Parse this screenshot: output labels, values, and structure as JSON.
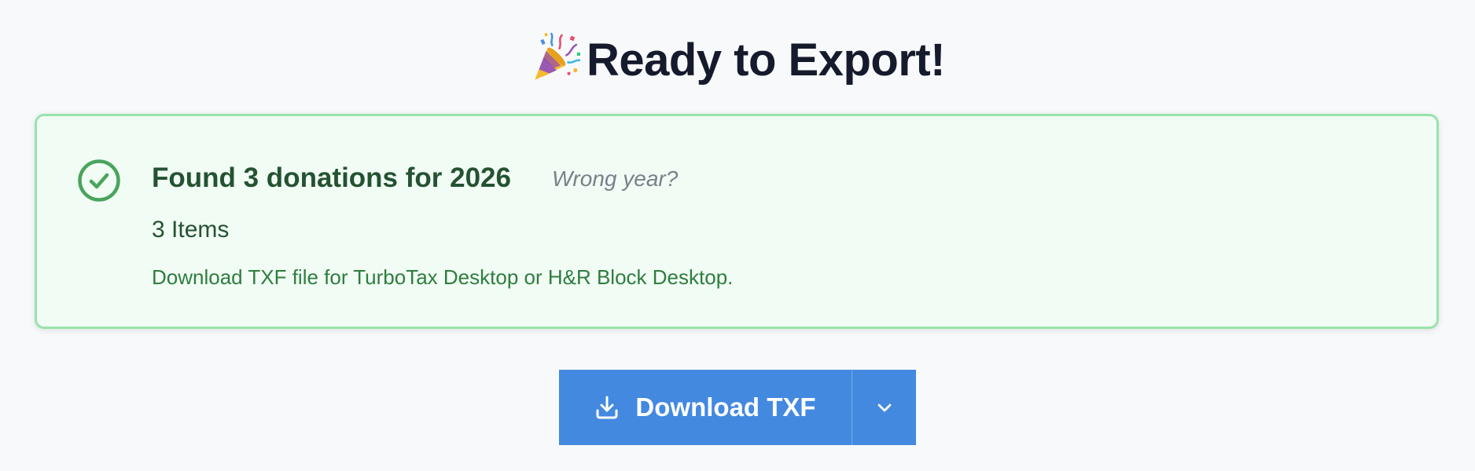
{
  "header": {
    "title": "Ready to Export!",
    "emoji_icon": "party-popper-icon"
  },
  "summary_card": {
    "status_icon": "check-circle-icon",
    "heading": "Found 3 donations for 2026",
    "wrong_year_link": "Wrong year?",
    "items_count": "3 Items",
    "description": "Download TXF file for TurboTax Desktop or H&R Block Desktop.",
    "colors": {
      "background": "#f1fcf4",
      "border": "#98e3ac",
      "heading": "#245232",
      "description": "#2e7d3f",
      "icon": "#4aa45c"
    }
  },
  "download": {
    "label": "Download TXF",
    "icon": "download-icon",
    "menu_icon": "chevron-down-icon",
    "color": "#4389e0"
  }
}
